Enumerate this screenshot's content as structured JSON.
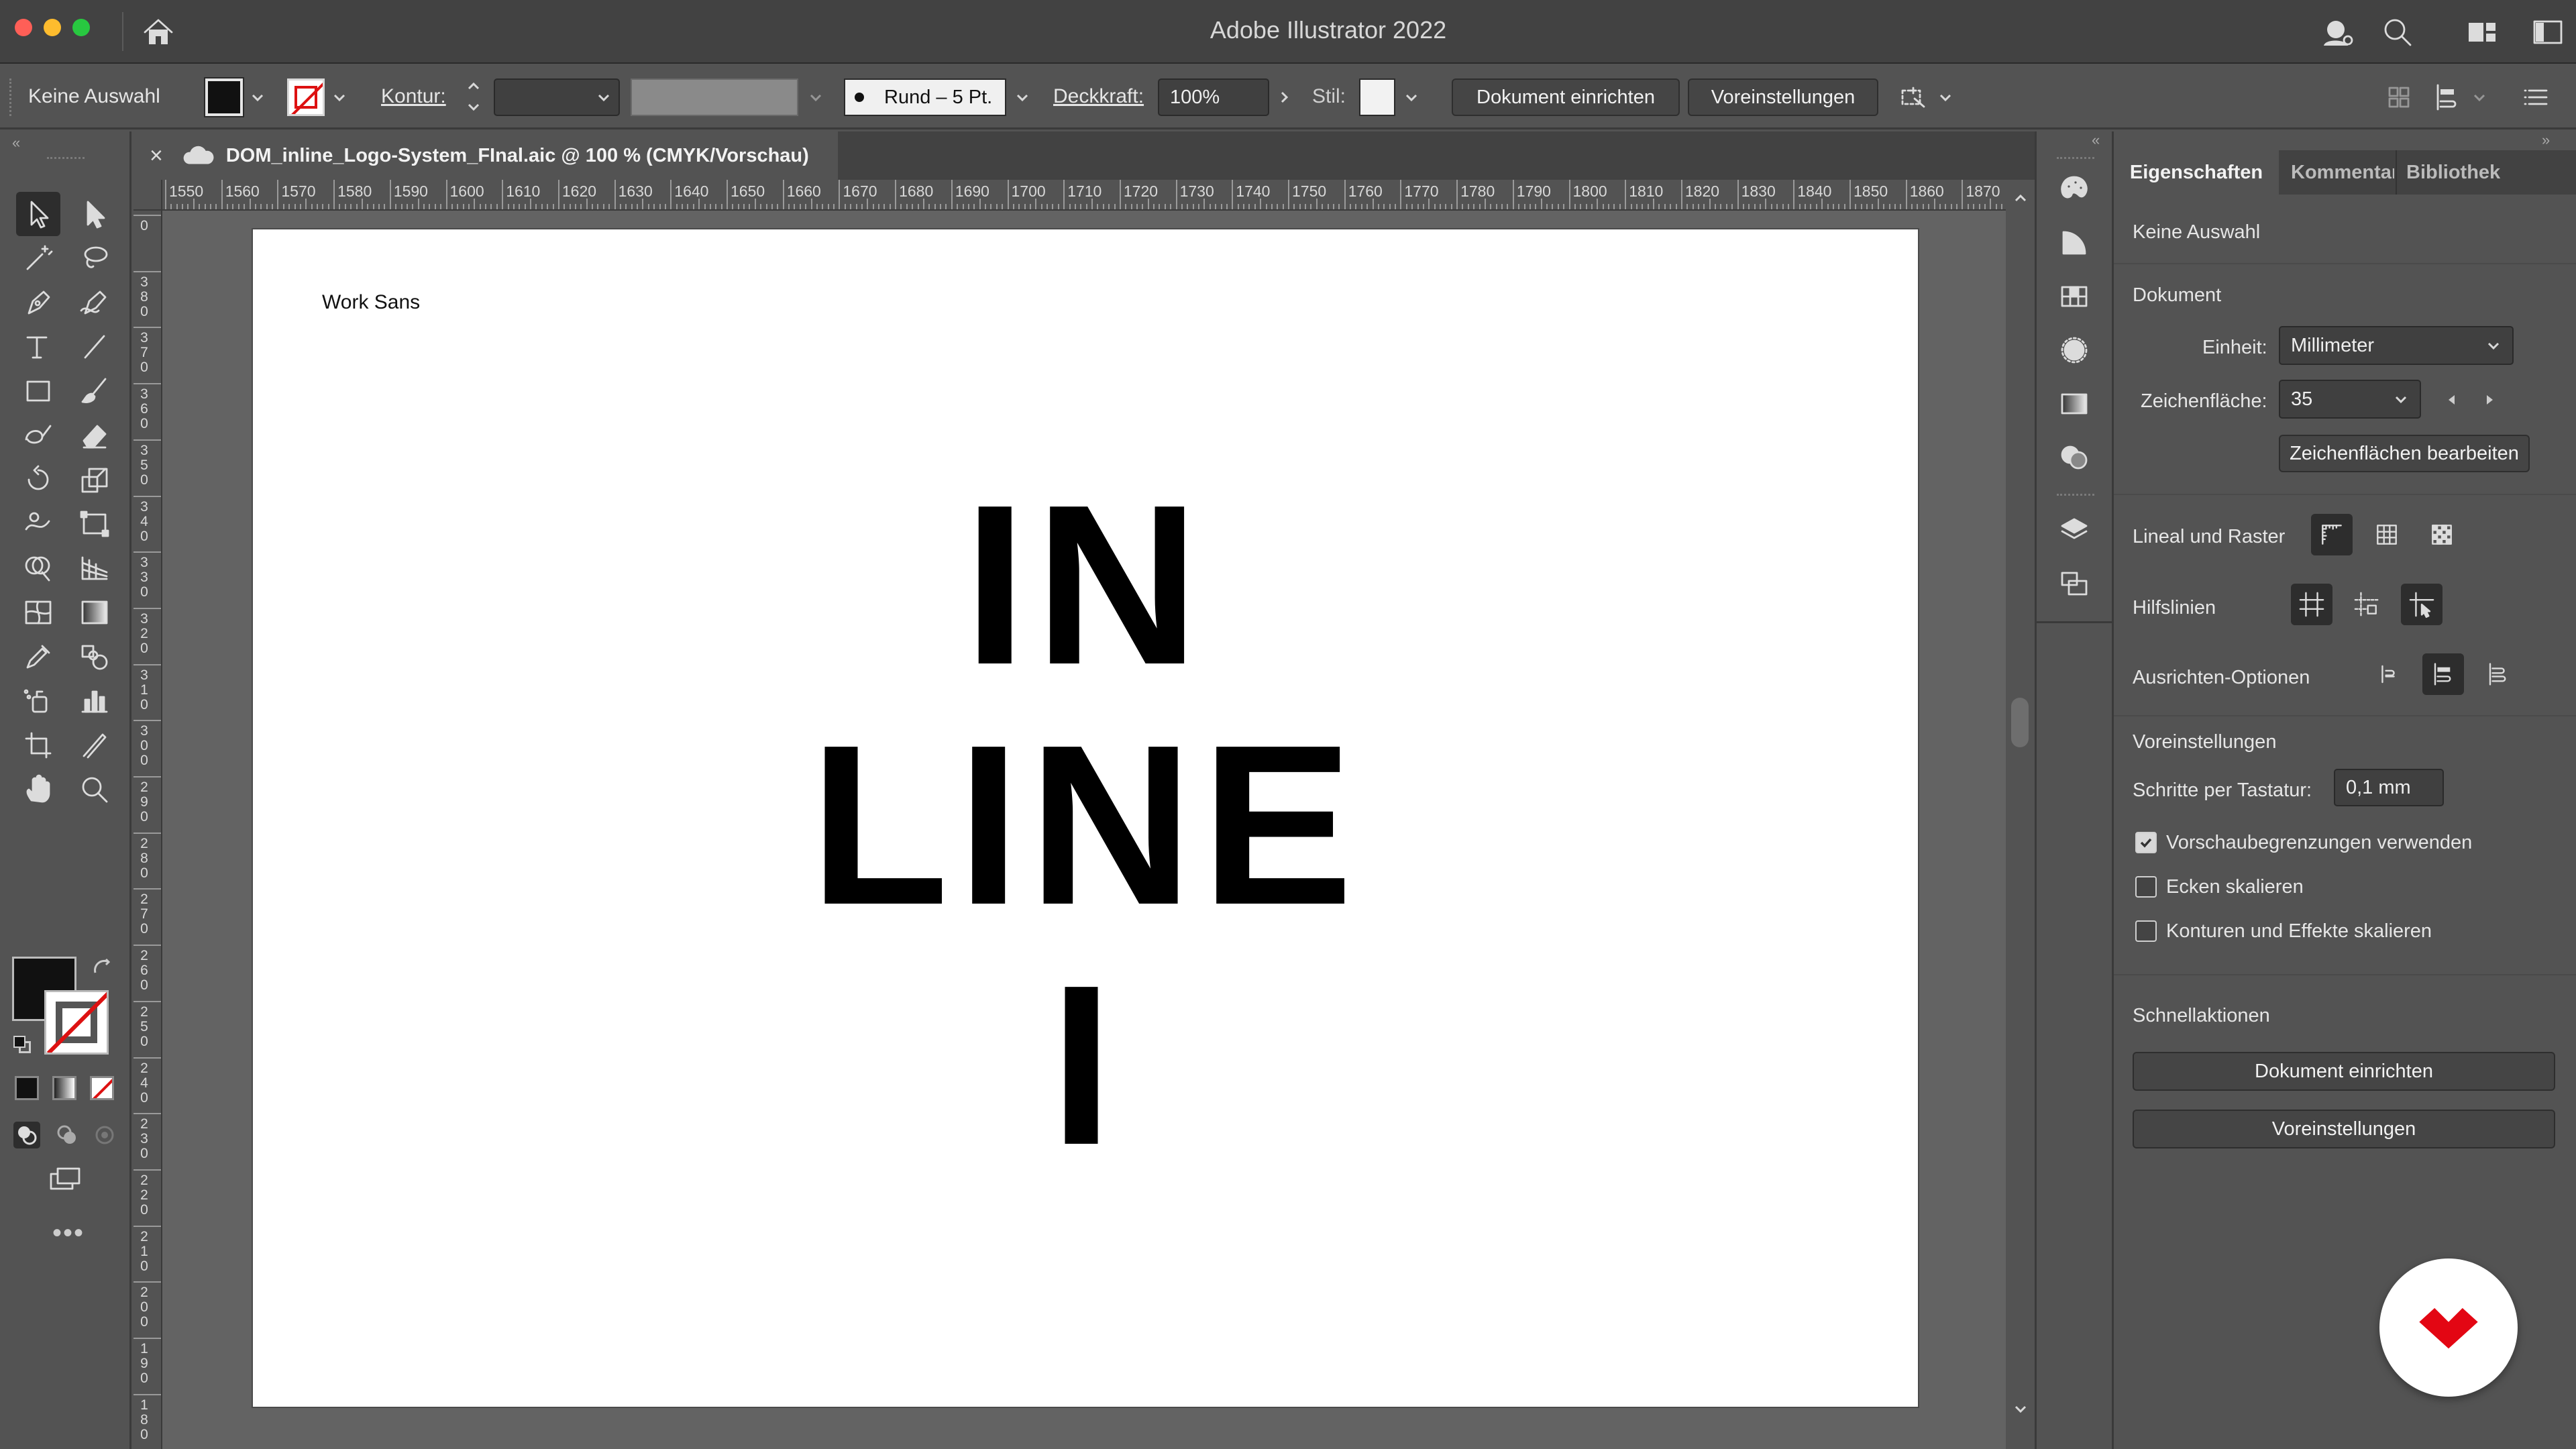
{
  "window": {
    "title": "Adobe Illustrator 2022"
  },
  "controlbar": {
    "selection_label": "Keine Auswahl",
    "stroke_label": "Kontur:",
    "brush_label": "Rund – 5 Pt.",
    "opacity_label": "Deckkraft:",
    "opacity_value": "100%",
    "style_label": "Stil:",
    "doc_setup_button": "Dokument einrichten",
    "preferences_button": "Voreinstellungen"
  },
  "document": {
    "tab_title": "DOM_inline_Logo-System_FInal.aic @ 100 % (CMYK/Vorschau)",
    "artboard_note": "Work Sans",
    "logo_lines": [
      "IN",
      "LINE",
      "I"
    ]
  },
  "ruler": {
    "h_ticks": [
      "1550",
      "1560",
      "1570",
      "1580",
      "1590",
      "1600",
      "1610",
      "1620",
      "1630",
      "1640",
      "1650",
      "1660",
      "1670",
      "1680",
      "1690",
      "1700",
      "1710",
      "1720",
      "1730",
      "1740",
      "1750",
      "1760",
      "1770",
      "1780",
      "1790",
      "1800",
      "1810",
      "1820",
      "1830",
      "1840",
      "1850",
      "1860",
      "1870"
    ],
    "v_ticks": [
      "0",
      "380",
      "370",
      "360",
      "350",
      "340",
      "330",
      "320",
      "310",
      "300",
      "290",
      "280",
      "270",
      "260",
      "250",
      "240",
      "230",
      "220",
      "210",
      "200",
      "190",
      "180"
    ]
  },
  "panel": {
    "tabs": [
      "Eigenschaften",
      "Kommentare",
      "Bibliothek"
    ],
    "no_selection": "Keine Auswahl",
    "document_heading": "Dokument",
    "unit_label": "Einheit:",
    "unit_value": "Millimeter",
    "artboard_label": "Zeichenfläche:",
    "artboard_value": "35",
    "edit_artboards_button": "Zeichenflächen bearbeiten",
    "rulers_grid_label": "Lineal und Raster",
    "guides_label": "Hilfslinien",
    "align_label": "Ausrichten-Optionen",
    "prefs_heading": "Voreinstellungen",
    "keyboard_increment_label": "Schritte per Tastatur:",
    "keyboard_increment_value": "0,1 mm",
    "checkbox_preview_bounds": "Vorschaubegrenzungen verwenden",
    "checkbox_preview_bounds_checked": true,
    "checkbox_scale_corners": "Ecken skalieren",
    "checkbox_scale_corners_checked": false,
    "checkbox_scale_strokes": "Konturen und Effekte skalieren",
    "checkbox_scale_strokes_checked": false,
    "quick_actions_heading": "Schnellaktionen",
    "quick_doc_setup": "Dokument einrichten",
    "quick_prefs": "Voreinstellungen"
  },
  "colors": {
    "badge_red": "#e30613",
    "traffic_red": "#ff5f57",
    "traffic_yellow": "#febc2e",
    "traffic_green": "#28c840"
  }
}
